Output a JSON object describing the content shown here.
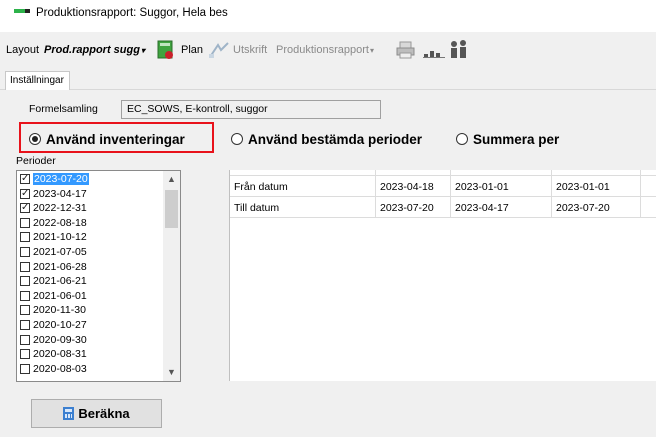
{
  "window": {
    "title": "Produktionsrapport: Suggor, Hela bes"
  },
  "toolbar": {
    "layout_label": "Layout",
    "layout_value": "Prod.rapport sugg",
    "plan_label": "Plan",
    "print_label": "Utskrift",
    "report_label": "Produktionsrapport",
    "icons": [
      "report-build-icon",
      "plan-icon",
      "print-icon",
      "chart-bars-icon",
      "people-icon"
    ],
    "colors": {
      "report_icon": "#3fa33f",
      "report_icon_accent": "#c8202a"
    }
  },
  "tabs": [
    {
      "label": "Inställningar"
    }
  ],
  "settings": {
    "formula_label": "Formelsamling",
    "formula_value": "EC_SOWS, E-kontroll, suggor",
    "radios": [
      {
        "label": "Använd inventeringar",
        "selected": true
      },
      {
        "label": "Använd bestämda perioder",
        "selected": false
      },
      {
        "label": "Summera per",
        "selected": false
      }
    ],
    "highlight_color": "#e8121b",
    "periods_label": "Perioder",
    "periods": [
      {
        "date": "2023-07-20",
        "checked": true,
        "selected": true
      },
      {
        "date": "2023-04-17",
        "checked": true,
        "selected": false
      },
      {
        "date": "2022-12-31",
        "checked": true,
        "selected": false
      },
      {
        "date": "2022-08-18",
        "checked": false,
        "selected": false
      },
      {
        "date": "2021-10-12",
        "checked": false,
        "selected": false
      },
      {
        "date": "2021-07-05",
        "checked": false,
        "selected": false
      },
      {
        "date": "2021-06-28",
        "checked": false,
        "selected": false
      },
      {
        "date": "2021-06-21",
        "checked": false,
        "selected": false
      },
      {
        "date": "2021-06-01",
        "checked": false,
        "selected": false
      },
      {
        "date": "2020-11-30",
        "checked": false,
        "selected": false
      },
      {
        "date": "2020-10-27",
        "checked": false,
        "selected": false
      },
      {
        "date": "2020-09-30",
        "checked": false,
        "selected": false
      },
      {
        "date": "2020-08-31",
        "checked": false,
        "selected": false
      },
      {
        "date": "2020-08-03",
        "checked": false,
        "selected": false
      }
    ],
    "selection_color": "#3399ff"
  },
  "grid": {
    "rows": [
      {
        "label": "Från datum",
        "values": [
          "2023-04-18",
          "2023-01-01",
          "2023-01-01"
        ]
      },
      {
        "label": "Till datum",
        "values": [
          "2023-07-20",
          "2023-04-17",
          "2023-07-20"
        ]
      }
    ]
  },
  "actions": {
    "calculate_label": "Beräkna"
  }
}
